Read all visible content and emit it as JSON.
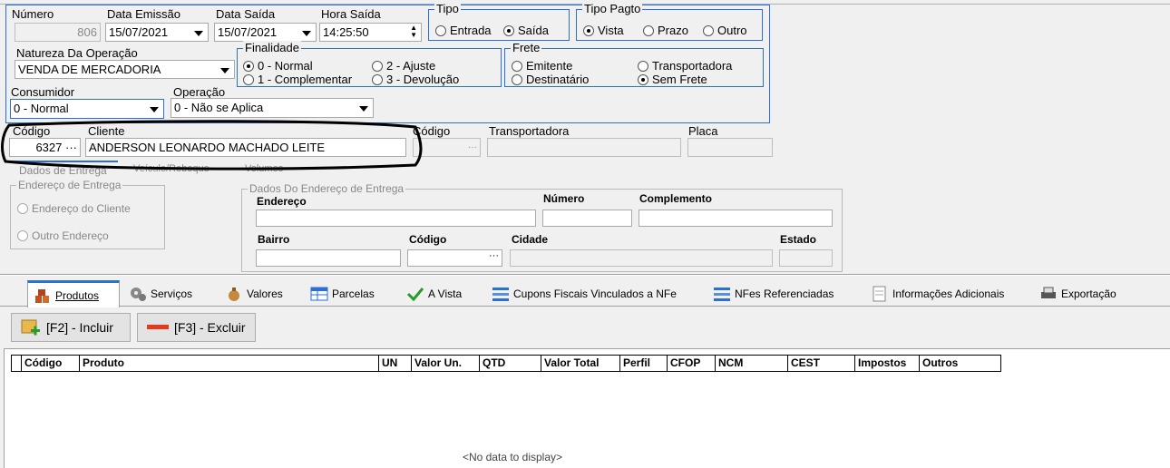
{
  "header": {
    "numero": {
      "label": "Número",
      "value": "806"
    },
    "data_emissao": {
      "label": "Data Emissão",
      "value": "15/07/2021"
    },
    "data_saida": {
      "label": "Data Saída",
      "value": "15/07/2021"
    },
    "hora_saida": {
      "label": "Hora Saída",
      "value": "14:25:50"
    },
    "tipo": {
      "title": "Tipo",
      "options": [
        "Entrada",
        "Saída"
      ],
      "selected": "Saída"
    },
    "tipo_pagto": {
      "title": "Tipo Pagto",
      "options": [
        "Vista",
        "Prazo",
        "Outro"
      ],
      "selected": "Vista"
    },
    "natureza": {
      "label": "Natureza Da Operação",
      "value": "VENDA DE MERCADORIA"
    },
    "finalidade": {
      "title": "Finalidade",
      "options": [
        "0 - Normal",
        "2 - Ajuste",
        "1 - Complementar",
        "3 - Devolução"
      ],
      "selected": "0 - Normal"
    },
    "frete": {
      "title": "Frete",
      "options": [
        "Emitente",
        "Transportadora",
        "Destinatário",
        "Sem Frete"
      ],
      "selected": "Sem Frete"
    },
    "consumidor": {
      "label": "Consumidor",
      "value": "0 - Normal"
    },
    "operacao": {
      "label": "Operação",
      "value": "0 - Não se Aplica"
    }
  },
  "cliente": {
    "codigo_label": "Código",
    "codigo_value": "6327",
    "cliente_label": "Cliente",
    "cliente_value": "ANDERSON LEONARDO MACHADO LEITE",
    "codigo2_label": "Código",
    "ellipsis": "···",
    "transportadora_label": "Transportadora",
    "placa_label": "Placa"
  },
  "entrega_tabs": [
    "Dados de Entrega",
    "Veículo/Reboque",
    "Volumes"
  ],
  "entrega": {
    "group_title": "Endereço de Entrega",
    "options": [
      "Endereço do Cliente",
      "Outro Endereço"
    ],
    "dados_title": "Dados Do Endereço de Entrega",
    "endereco": "Endereço",
    "numero": "Número",
    "complemento": "Complemento",
    "bairro": "Bairro",
    "codigo": "Código",
    "cidade": "Cidade",
    "estado": "Estado"
  },
  "main_tabs": [
    {
      "label": "Produtos",
      "icon": "boxes-icon"
    },
    {
      "label": "Serviços",
      "icon": "gears-icon"
    },
    {
      "label": "Valores",
      "icon": "money-bag-icon"
    },
    {
      "label": "Parcelas",
      "icon": "table-icon"
    },
    {
      "label": "A Vista",
      "icon": "check-icon"
    },
    {
      "label": "Cupons Fiscais Vinculados a NFe",
      "icon": "list-icon"
    },
    {
      "label": "NFes Referenciadas",
      "icon": "list-icon"
    },
    {
      "label": "Informações Adicionais",
      "icon": "document-icon"
    },
    {
      "label": "Exportação",
      "icon": "printer-icon"
    }
  ],
  "toolbar": {
    "incluir": "[F2] - Incluir",
    "excluir": "[F3] - Excluir"
  },
  "grid": {
    "columns": [
      "Código",
      "Produto",
      "UN",
      "Valor Un.",
      "QTD",
      "Valor Total",
      "Perfil",
      "CFOP",
      "NCM",
      "CEST",
      "Impostos",
      "Outros"
    ],
    "empty_text": "<No data to display>"
  },
  "colors": {
    "accent": "#2a6fd6",
    "annotation": "#000000"
  }
}
